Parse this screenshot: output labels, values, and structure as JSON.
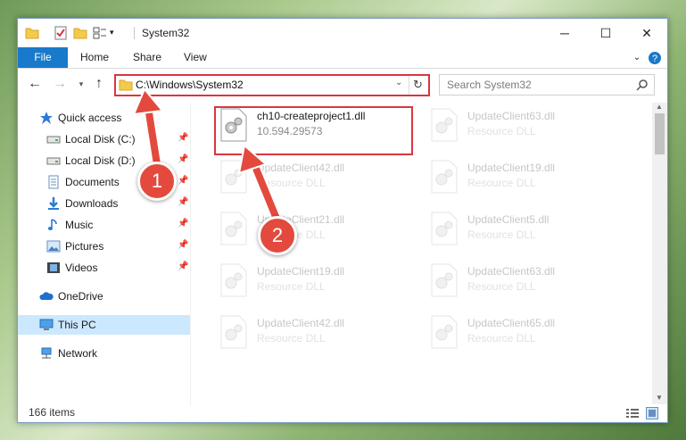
{
  "window": {
    "title": "System32",
    "controls": {
      "minimize": "─",
      "maximize": "☐",
      "close": "✕"
    }
  },
  "ribbon": {
    "file_label": "File",
    "tabs": [
      "Home",
      "Share",
      "View"
    ]
  },
  "address_bar": {
    "path": "C:\\Windows\\System32",
    "search_placeholder": "Search System32"
  },
  "sidebar": {
    "items": [
      {
        "label": "Quick access",
        "icon": "star-icon"
      },
      {
        "label": "Local Disk (C:)",
        "icon": "drive-icon",
        "pinned": true
      },
      {
        "label": "Local Disk (D:)",
        "icon": "drive-icon",
        "pinned": true
      },
      {
        "label": "Documents",
        "icon": "documents-icon",
        "pinned": true
      },
      {
        "label": "Downloads",
        "icon": "download-icon",
        "pinned": true
      },
      {
        "label": "Music",
        "icon": "music-icon",
        "pinned": true
      },
      {
        "label": "Pictures",
        "icon": "pictures-icon",
        "pinned": true
      },
      {
        "label": "Videos",
        "icon": "videos-icon",
        "pinned": true
      },
      {
        "label": "OneDrive",
        "icon": "cloud-icon"
      },
      {
        "label": "This PC",
        "icon": "computer-icon",
        "selected": true
      },
      {
        "label": "Network",
        "icon": "network-icon"
      }
    ]
  },
  "files": [
    {
      "name": "ch10-createproject1.dll",
      "desc": "10.594.29573",
      "highlighted": true
    },
    {
      "name": "UpdateClient63.dll",
      "desc": "Resource DLL"
    },
    {
      "name": "UpdateClient42.dll",
      "desc": "Resource DLL"
    },
    {
      "name": "UpdateClient19.dll",
      "desc": "Resource DLL"
    },
    {
      "name": "UpdateClient21.dll",
      "desc": "Resource DLL"
    },
    {
      "name": "UpdateClient5.dll",
      "desc": "Resource DLL"
    },
    {
      "name": "UpdateClient19.dll",
      "desc": "Resource DLL"
    },
    {
      "name": "UpdateClient63.dll",
      "desc": "Resource DLL"
    },
    {
      "name": "UpdateClient42.dll",
      "desc": "Resource DLL"
    },
    {
      "name": "UpdateClient65.dll",
      "desc": "Resource DLL"
    }
  ],
  "status": {
    "item_count": "166 items"
  },
  "annotations": {
    "step1": "1",
    "step2": "2",
    "color": "#e34a3d"
  }
}
